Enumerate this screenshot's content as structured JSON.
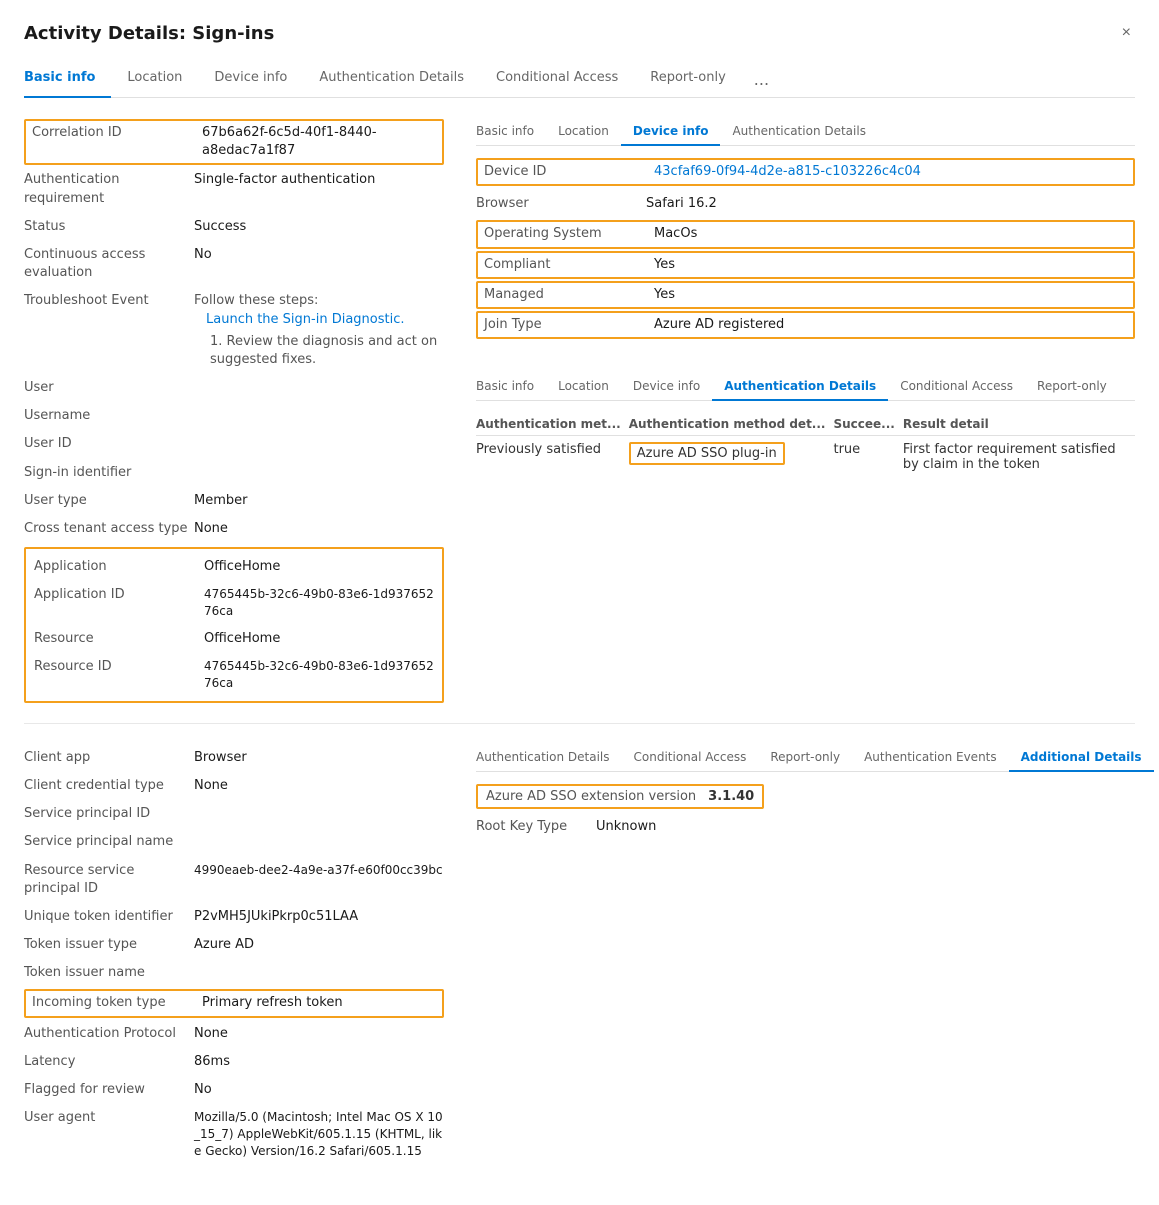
{
  "dialog": {
    "title": "Activity Details: Sign-ins",
    "close_label": "×"
  },
  "main_tabs": [
    {
      "label": "Basic info",
      "active": true
    },
    {
      "label": "Location",
      "active": false
    },
    {
      "label": "Device info",
      "active": false
    },
    {
      "label": "Authentication Details",
      "active": false
    },
    {
      "label": "Conditional Access",
      "active": false
    },
    {
      "label": "Report-only",
      "active": false
    },
    {
      "label": "...",
      "active": false
    }
  ],
  "basic_info": {
    "correlation_id_label": "Correlation ID",
    "correlation_id_value": "67b6a62f-6c5d-40f1-8440-a8edac7a1f87",
    "auth_req_label": "Authentication requirement",
    "auth_req_value": "Single-factor authentication",
    "status_label": "Status",
    "status_value": "Success",
    "cae_label": "Continuous access evaluation",
    "cae_value": "No",
    "troubleshoot_label": "Troubleshoot Event",
    "troubleshoot_prefix": "Follow these steps:",
    "troubleshoot_link": "Launch the Sign-in Diagnostic.",
    "troubleshoot_step": "1. Review the diagnosis and act on suggested fixes.",
    "user_label": "User",
    "user_value": "",
    "username_label": "Username",
    "username_value": "",
    "user_id_label": "User ID",
    "user_id_value": "",
    "sign_in_id_label": "Sign-in identifier",
    "sign_in_id_value": "",
    "user_type_label": "User type",
    "user_type_value": "Member",
    "cross_tenant_label": "Cross tenant access type",
    "cross_tenant_value": "None",
    "application_label": "Application",
    "application_value": "OfficeHome",
    "app_id_label": "Application ID",
    "app_id_value": "4765445b-32c6-49b0-83e6-1d93765276ca",
    "resource_label": "Resource",
    "resource_value": "OfficeHome",
    "resource_id_label": "Resource ID",
    "resource_id_value": "4765445b-32c6-49b0-83e6-1d93765276ca"
  },
  "device_mini_tabs": [
    {
      "label": "Basic info"
    },
    {
      "label": "Location"
    },
    {
      "label": "Device info",
      "active": true
    },
    {
      "label": "Authentication Details"
    }
  ],
  "device_info": {
    "device_id_label": "Device ID",
    "device_id_value": "43cfaf69-0f94-4d2e-a815-c103226c4c04",
    "browser_label": "Browser",
    "browser_value": "Safari 16.2",
    "os_label": "Operating System",
    "os_value": "MacOs",
    "compliant_label": "Compliant",
    "compliant_value": "Yes",
    "managed_label": "Managed",
    "managed_value": "Yes",
    "join_type_label": "Join Type",
    "join_type_value": "Azure AD registered"
  },
  "auth_mini_tabs": [
    {
      "label": "Basic info"
    },
    {
      "label": "Location"
    },
    {
      "label": "Device info"
    },
    {
      "label": "Authentication Details",
      "active": true
    },
    {
      "label": "Conditional Access"
    },
    {
      "label": "Report-only"
    }
  ],
  "auth_details": {
    "col1": "Authentication met...",
    "col2": "Authentication method det...",
    "col3": "Succee...",
    "col4": "Result detail",
    "row1": {
      "col1": "Previously satisfied",
      "col2": "Azure AD SSO plug-in",
      "col3": "true",
      "col4": "First factor requirement satisfied by claim in the token"
    }
  },
  "additional_mini_tabs": [
    {
      "label": "Authentication Details"
    },
    {
      "label": "Conditional Access"
    },
    {
      "label": "Report-only"
    },
    {
      "label": "Authentication Events"
    },
    {
      "label": "Additional Details",
      "active": true
    }
  ],
  "additional_details": {
    "sso_version_label": "Azure AD SSO extension version",
    "sso_version_value": "3.1.40",
    "root_key_label": "Root Key Type",
    "root_key_value": "Unknown"
  },
  "bottom_info": {
    "client_app_label": "Client app",
    "client_app_value": "Browser",
    "client_cred_label": "Client credential type",
    "client_cred_value": "None",
    "sp_id_label": "Service principal ID",
    "sp_id_value": "",
    "sp_name_label": "Service principal name",
    "sp_name_value": "",
    "resource_sp_label": "Resource service principal ID",
    "resource_sp_value": "4990eaeb-dee2-4a9e-a37f-e60f00cc39bc",
    "token_id_label": "Unique token identifier",
    "token_id_value": "P2vMH5JUkiPkrp0c51LAA",
    "token_issuer_type_label": "Token issuer type",
    "token_issuer_type_value": "Azure AD",
    "token_issuer_name_label": "Token issuer name",
    "token_issuer_name_value": "",
    "incoming_token_label": "Incoming token type",
    "incoming_token_value": "Primary refresh token",
    "auth_protocol_label": "Authentication Protocol",
    "auth_protocol_value": "None",
    "latency_label": "Latency",
    "latency_value": "86ms",
    "flagged_label": "Flagged for review",
    "flagged_value": "No",
    "user_agent_label": "User agent",
    "user_agent_value": "Mozilla/5.0 (Macintosh; Intel Mac OS X 10_15_7) AppleWebKit/605.1.15 (KHTML, like Gecko) Version/16.2 Safari/605.1.15"
  }
}
